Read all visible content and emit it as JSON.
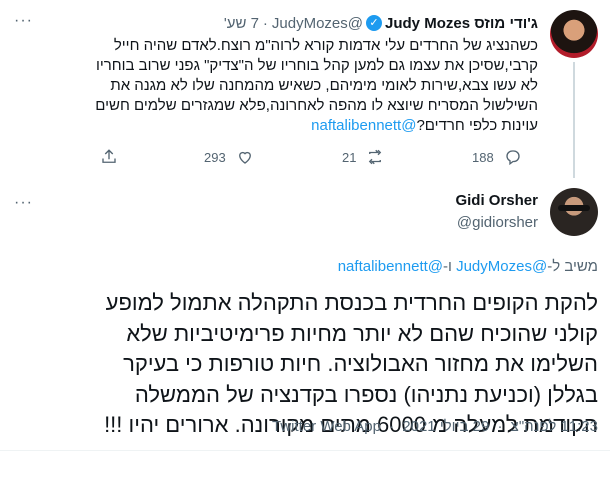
{
  "parent_tweet": {
    "author_name": "ג'ודי מוזס Judy Mozes",
    "author_handle": "@JudyMozes",
    "time_ago": "7 שע'",
    "separator": "·",
    "more_label": "···",
    "body_lines": [
      "כשהנציג של החרדים עלי אדמות קורא לרוה\"מ רוצח.לאדם שהיה חייל",
      "קרבי,שסיכן את עצמו גם למען קהל בוחריו של ה\"צדיק\" גפני שרוב בוחריו",
      "לא עשו צבא,שירות לאומי מימיהם, כשאיש מהמחנה שלו לא מגנה את",
      "השילשול המסריח שיוצא לו מהפה לאחרונה,פלא שמגזרים שלמים חשים"
    ],
    "body_last_text": "עוינות  כלפי חרדים?",
    "body_last_mention": "@naftalibennett",
    "stats": {
      "share": "",
      "likes": "293",
      "retweets": "21",
      "replies": "188"
    }
  },
  "main_tweet": {
    "author_name": "Gidi Orsher",
    "author_handle": "@gidiorsher",
    "more_label": "···",
    "replying_prefix": "משיב ל-",
    "replying_mention_1": "@JudyMozes",
    "replying_joiner": " ו-",
    "replying_mention_2": "@naftalibennett",
    "text_lines": [
      "להקת הקופים החרדית בכנסת התקהלה אתמול למופע",
      "קולני שהוכיח שהם לא יותר מחיות פרימיטיביות שלא",
      "השלימו את מחזור האבולוציה. חיות טורפות כי בעיקר",
      "בגללן (וכניעת נתניהו) נספרו בקדנציה של הממשלה",
      "הקודמת למעלה מ 6000 מתים מקורונה. ארורים יהיו !!!"
    ],
    "time": "11:23 לפנה\"צ",
    "date": "29 ביולי 2021",
    "client": "Twitter Web App",
    "separator": "·"
  },
  "colors": {
    "accent": "#1d9bf0",
    "muted": "#536471",
    "text": "#0f1419"
  },
  "icons": [
    "verified-badge-icon",
    "more-icon",
    "share-icon",
    "like-icon",
    "retweet-icon",
    "reply-icon"
  ]
}
